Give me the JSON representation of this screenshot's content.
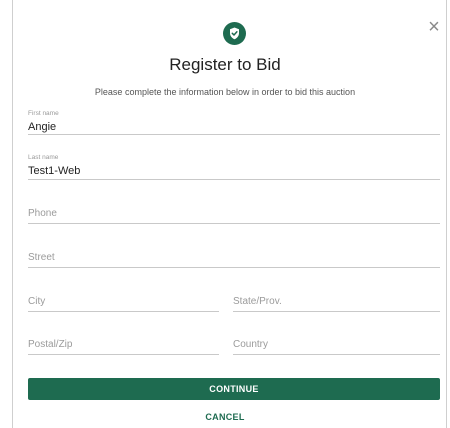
{
  "dialog": {
    "title": "Register to Bid",
    "subtitle": "Please complete the information below in order to bid this auction",
    "close_glyph": "×",
    "icon": "shield-check-icon",
    "accent_color": "#1e6b50"
  },
  "form": {
    "first_name": {
      "label": "First name",
      "value": "Angie"
    },
    "last_name": {
      "label": "Last name",
      "value": "Test1-Web"
    },
    "phone": {
      "placeholder": "Phone"
    },
    "street": {
      "placeholder": "Street"
    },
    "city": {
      "placeholder": "City"
    },
    "state": {
      "placeholder": "State/Prov."
    },
    "postal": {
      "placeholder": "Postal/Zip"
    },
    "country": {
      "placeholder": "Country"
    }
  },
  "actions": {
    "continue_label": "CONTINUE",
    "cancel_label": "CANCEL"
  }
}
